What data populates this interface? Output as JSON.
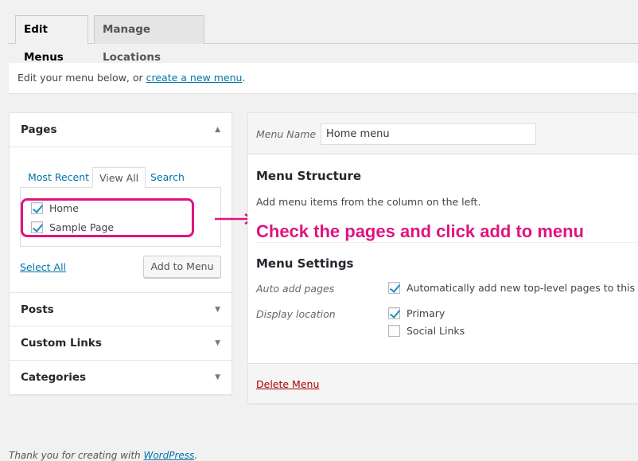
{
  "tabs": [
    {
      "label": "Edit Menus",
      "active": true
    },
    {
      "label": "Manage Locations",
      "active": false
    }
  ],
  "notice": {
    "text": "Edit your menu below, or ",
    "link": "create a new menu",
    "suffix": "."
  },
  "left": {
    "pages": {
      "title": "Pages",
      "tabs": [
        "Most Recent",
        "View All",
        "Search"
      ],
      "items": [
        {
          "label": "Home",
          "checked": true
        },
        {
          "label": "Sample Page",
          "checked": true
        }
      ],
      "select_all": "Select All",
      "add_button": "Add to Menu"
    },
    "sections": [
      "Posts",
      "Custom Links",
      "Categories"
    ]
  },
  "right": {
    "menu_name_label": "Menu Name",
    "menu_name_value": "Home menu",
    "structure_title": "Menu Structure",
    "structure_desc": "Add menu items from the column on the left.",
    "annotation": "Check the pages and click add to menu",
    "settings_title": "Menu Settings",
    "auto_add_label": "Auto add pages",
    "auto_add_text": "Automatically add new top-level pages to this menu",
    "auto_add_checked": true,
    "display_label": "Display location",
    "locations": [
      {
        "label": "Primary",
        "checked": true
      },
      {
        "label": "Social Links",
        "checked": false
      }
    ],
    "delete": "Delete Menu"
  },
  "footer": {
    "text": "Thank you for creating with ",
    "link": "WordPress",
    "suffix": "."
  },
  "colors": {
    "annotation": "#e0147f",
    "link": "#0073aa",
    "delete": "#a00"
  }
}
